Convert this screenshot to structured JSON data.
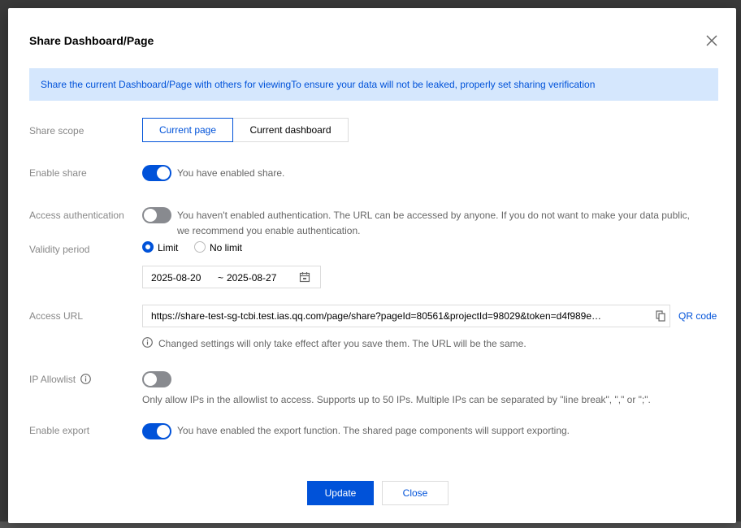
{
  "dialog": {
    "title": "Share Dashboard/Page",
    "banner": "Share the current Dashboard/Page with others for viewingTo ensure your data will not be leaked, properly set sharing verification"
  },
  "share_scope": {
    "label": "Share scope",
    "options": [
      "Current page",
      "Current dashboard"
    ],
    "selected": "Current page"
  },
  "enable_share": {
    "label": "Enable share",
    "enabled": true,
    "text": "You have enabled share."
  },
  "access_auth": {
    "label": "Access authentication",
    "enabled": false,
    "text_line1": "You haven't enabled authentication. The URL can be accessed by anyone. If you do not want to make your data public,",
    "text_line2": "we recommend you enable authentication."
  },
  "validity": {
    "label": "Validity period",
    "options": [
      "Limit",
      "No limit"
    ],
    "selected": "Limit",
    "start_date": "2025-08-20",
    "separator": "~",
    "end_date": "2025-08-27"
  },
  "access_url": {
    "label": "Access URL",
    "value": "https://share-test-sg-tcbi.test.ias.qq.com/page/share?pageId=80561&projectId=98029&token=d4f989e…",
    "qr_label": "QR code",
    "note": "Changed settings will only take effect after you save them. The URL will be the same."
  },
  "ip_allowlist": {
    "label": "IP Allowlist",
    "enabled": false,
    "text": "Only allow IPs in the allowlist to access. Supports up to 50 IPs. Multiple IPs can be separated by \"line break\", \",\" or \";\"."
  },
  "enable_export": {
    "label": "Enable export",
    "enabled": true,
    "text": "You have enabled the export function. The shared page components will support exporting."
  },
  "footer": {
    "update_label": "Update",
    "close_label": "Close"
  },
  "colors": {
    "accent": "#0052d9",
    "banner_bg": "#d5e7fd",
    "toggle_off": "#888a8f"
  }
}
